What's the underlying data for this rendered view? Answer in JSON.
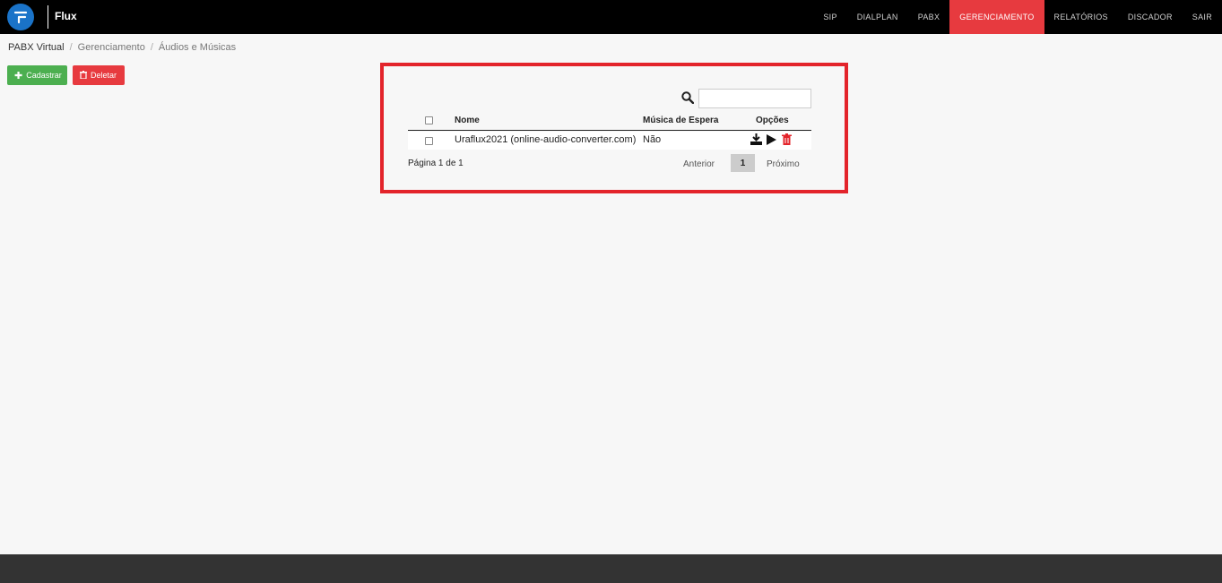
{
  "brand": {
    "name": "Flux"
  },
  "nav": {
    "items": [
      {
        "label": "SIP"
      },
      {
        "label": "DIALPLAN"
      },
      {
        "label": "PABX"
      },
      {
        "label": "GERENCIAMENTO"
      },
      {
        "label": "RELATÓRIOS"
      },
      {
        "label": "DISCADOR"
      },
      {
        "label": "SAIR"
      }
    ],
    "active": "GERENCIAMENTO"
  },
  "breadcrumb": [
    "PABX Virtual",
    "Gerenciamento",
    "Áudios e Músicas"
  ],
  "actions": {
    "add_label": "Cadastrar",
    "delete_label": "Deletar"
  },
  "search": {
    "value": "",
    "placeholder": ""
  },
  "table": {
    "columns": [
      "Nome",
      "Música de Espera",
      "Opções"
    ],
    "rows": [
      {
        "name": "Uraflux2021 (online-audio-converter.com)",
        "hold_music": "Não",
        "options": [
          "download-icon",
          "play-icon",
          "trash-icon"
        ]
      }
    ]
  },
  "pagination": {
    "info": "Página 1 de 1",
    "prev_label": "Anterior",
    "current": "1",
    "next_label": "Próximo"
  },
  "colors": {
    "accent": "#e73a3f",
    "success": "#4caf50",
    "topbar": "#000000",
    "highlight": "#e3242b"
  }
}
